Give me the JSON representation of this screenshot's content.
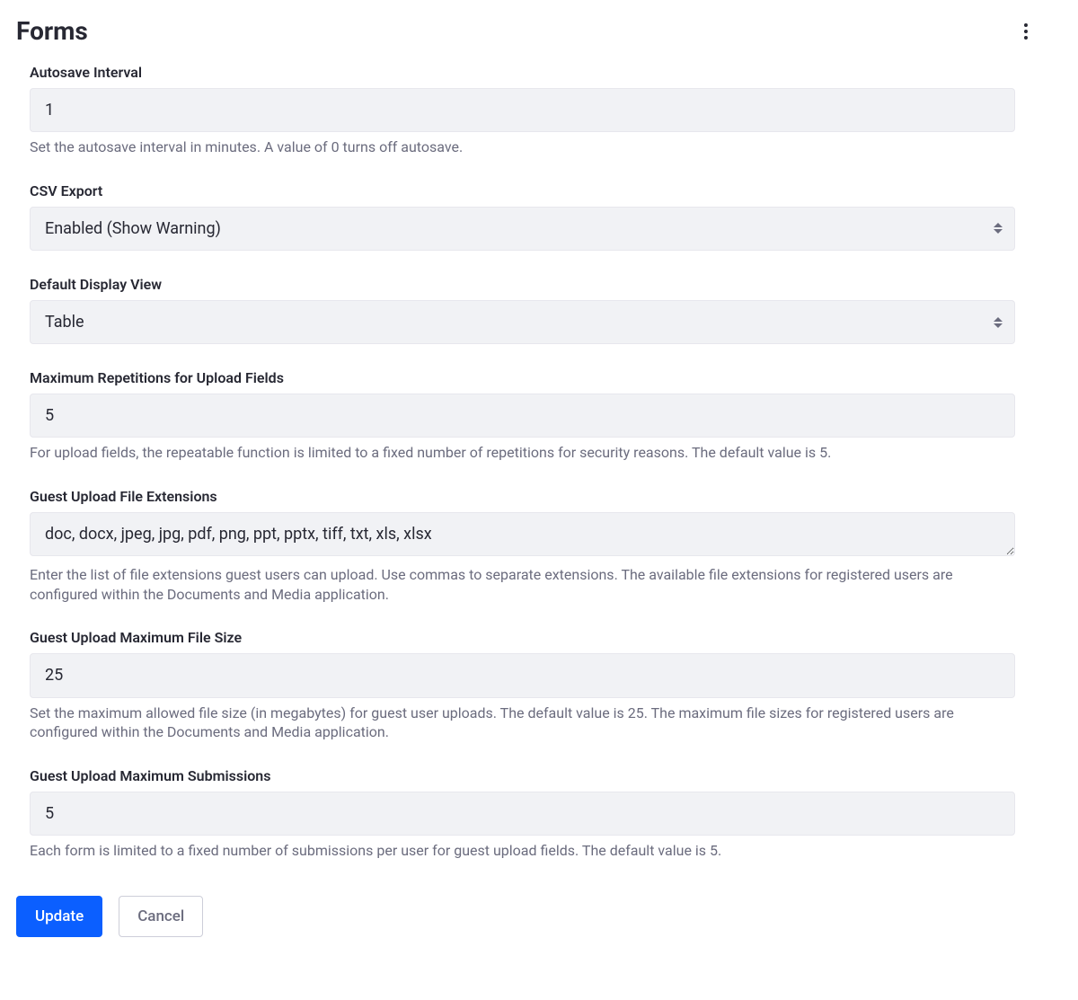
{
  "page": {
    "title": "Forms"
  },
  "fields": {
    "autosave": {
      "label": "Autosave Interval",
      "value": "1",
      "help": "Set the autosave interval in minutes. A value of 0 turns off autosave."
    },
    "csv_export": {
      "label": "CSV Export",
      "value": "Enabled (Show Warning)"
    },
    "default_view": {
      "label": "Default Display View",
      "value": "Table"
    },
    "max_repetitions": {
      "label": "Maximum Repetitions for Upload Fields",
      "value": "5",
      "help": "For upload fields, the repeatable function is limited to a fixed number of repetitions for security reasons. The default value is 5."
    },
    "guest_extensions": {
      "label": "Guest Upload File Extensions",
      "value": "doc, docx, jpeg, jpg, pdf, png, ppt, pptx, tiff, txt, xls, xlsx",
      "help": "Enter the list of file extensions guest users can upload. Use commas to separate extensions. The available file extensions for registered users are configured within the Documents and Media application."
    },
    "guest_max_size": {
      "label": "Guest Upload Maximum File Size",
      "value": "25",
      "help": "Set the maximum allowed file size (in megabytes) for guest user uploads. The default value is 25. The maximum file sizes for registered users are configured within the Documents and Media application."
    },
    "guest_max_submissions": {
      "label": "Guest Upload Maximum Submissions",
      "value": "5",
      "help": "Each form is limited to a fixed number of submissions per user for guest upload fields. The default value is 5."
    }
  },
  "buttons": {
    "update": "Update",
    "cancel": "Cancel"
  }
}
